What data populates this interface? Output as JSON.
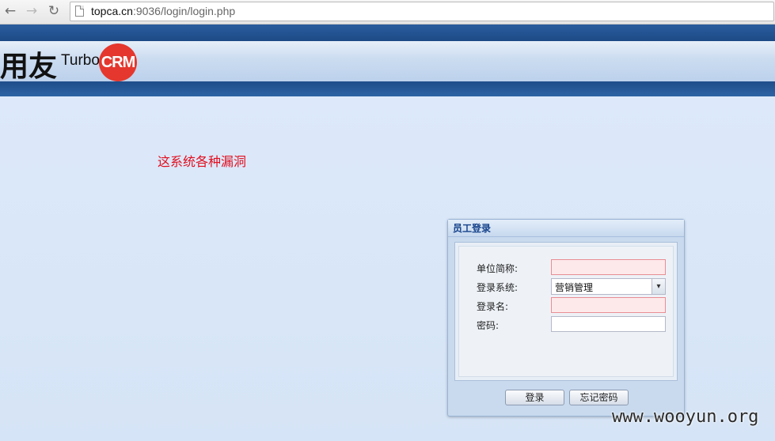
{
  "browser": {
    "back_icon": "←",
    "forward_icon": "→",
    "reload_icon": "↻",
    "url_host": "topca.cn",
    "url_rest": ":9036/login/login.php"
  },
  "header": {
    "logo_cn": "用友",
    "logo_turbo": "Turbo",
    "logo_crm": "CRM"
  },
  "notice": "这系统各种漏洞",
  "login": {
    "title": "员工登录",
    "fields": [
      {
        "label": "单位简称:",
        "value": ""
      },
      {
        "label": "登录系统:",
        "value": "营销管理"
      },
      {
        "label": "登录名:",
        "value": ""
      },
      {
        "label": "密码:",
        "value": ""
      }
    ],
    "login_button": "登录",
    "forgot_button": "忘记密码"
  },
  "watermark": "www.wooyun.org"
}
